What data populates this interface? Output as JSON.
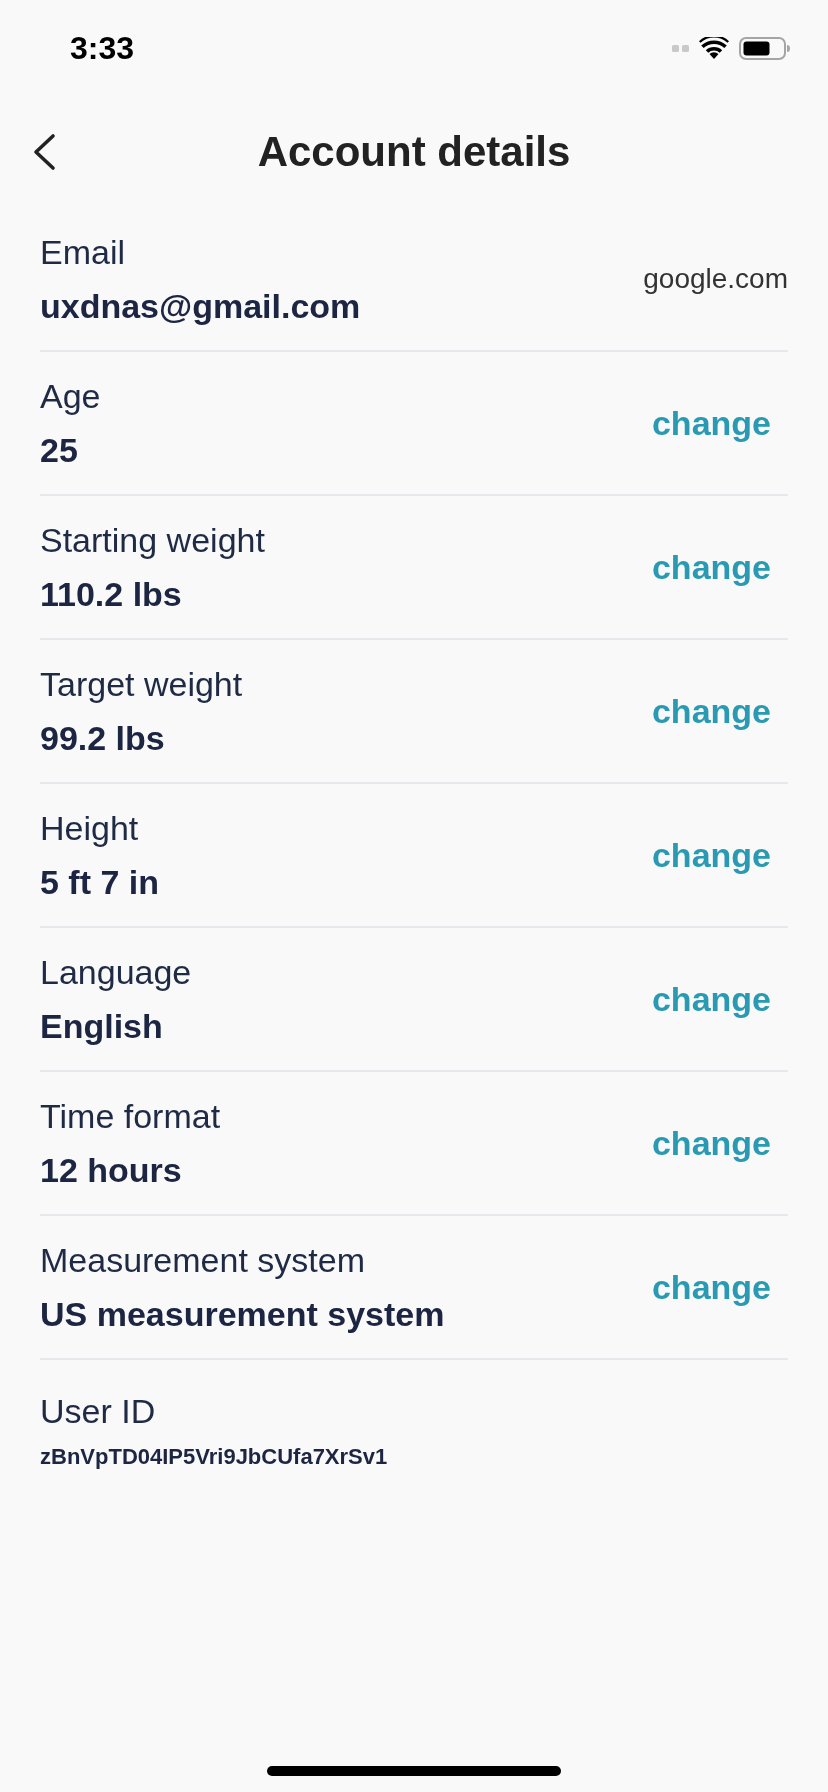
{
  "status_bar": {
    "time": "3:33"
  },
  "header": {
    "title": "Account details"
  },
  "rows": [
    {
      "kind": "linked",
      "label": "Email",
      "value": "uxdnas@gmail.com",
      "note": "google.com"
    },
    {
      "kind": "editable",
      "label": "Age",
      "value": "25",
      "action": "change"
    },
    {
      "kind": "editable",
      "label": "Starting weight",
      "value": "110.2 lbs",
      "action": "change"
    },
    {
      "kind": "editable",
      "label": "Target weight",
      "value": "99.2 lbs",
      "action": "change"
    },
    {
      "kind": "editable",
      "label": "Height",
      "value": "5 ft 7 in",
      "action": "change"
    },
    {
      "kind": "editable",
      "label": "Language",
      "value": "English",
      "action": "change"
    },
    {
      "kind": "editable",
      "label": "Time format",
      "value": "12 hours",
      "action": "change"
    },
    {
      "kind": "editable",
      "label": "Measurement system",
      "value": "US measurement system",
      "action": "change"
    },
    {
      "kind": "id",
      "label": "User ID",
      "value": "zBnVpTD04IP5Vri9JbCUfa7XrSv1"
    }
  ]
}
